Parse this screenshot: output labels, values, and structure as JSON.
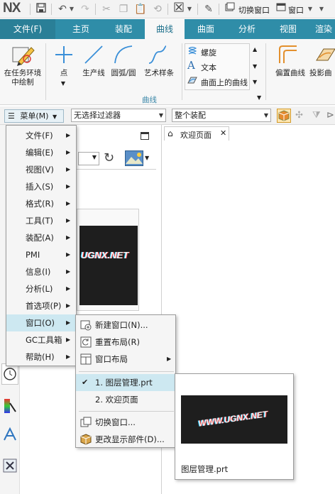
{
  "app": {
    "logo": "NX"
  },
  "quick_access": {
    "switch_window": "切换窗口",
    "window_menu": "窗口"
  },
  "tabs": [
    {
      "label": "文件(F)"
    },
    {
      "label": "主页"
    },
    {
      "label": "装配"
    },
    {
      "label": "曲线"
    },
    {
      "label": "曲面"
    },
    {
      "label": "分析"
    },
    {
      "label": "视图"
    },
    {
      "label": "渲染"
    }
  ],
  "ribbon": {
    "sketch_in_task": "在任务环境中绘制",
    "point": "点",
    "production_line": "生产线",
    "arc_circle": "圆弧/圆",
    "art_spline": "艺术样条",
    "helix": "螺旋",
    "text": "文本",
    "curve_on_surface": "曲面上的曲线",
    "offset_curve": "偏置曲线",
    "projection": "投影曲",
    "group_label": "曲线"
  },
  "filterbar": {
    "menu_button": "菜单(M)",
    "filter_select": "无选择过滤器",
    "scope_select": "整个装配"
  },
  "welcome_tab": {
    "label": "欢迎页面"
  },
  "nav_thumb": {
    "logo_text": "UGNX.NET"
  },
  "main_menu": {
    "items": [
      {
        "label": "文件(F)"
      },
      {
        "label": "编辑(E)"
      },
      {
        "label": "视图(V)"
      },
      {
        "label": "插入(S)"
      },
      {
        "label": "格式(R)"
      },
      {
        "label": "工具(T)"
      },
      {
        "label": "装配(A)"
      },
      {
        "label": "PMI"
      },
      {
        "label": "信息(I)"
      },
      {
        "label": "分析(L)"
      },
      {
        "label": "首选项(P)"
      },
      {
        "label": "窗口(O)"
      },
      {
        "label": "GC工具箱"
      },
      {
        "label": "帮助(H)"
      }
    ]
  },
  "window_menu": {
    "new_window": "新建窗口(N)...",
    "reset_layout": "重置布局(R)",
    "window_layout": "窗口布局",
    "doc1": "1. 图层管理.prt",
    "doc2": "2. 欢迎页面",
    "switch_window": "切换窗口...",
    "change_display_part": "更改显示部件(D)..."
  },
  "preview": {
    "logo_text": "WWW.UGNX.NET",
    "caption": "图层管理.prt"
  },
  "colors": {
    "ribbon_tab_bar": "#2f8da8",
    "menu_highlight": "#cde8f1",
    "preview_bg": "#1e1e1e"
  }
}
